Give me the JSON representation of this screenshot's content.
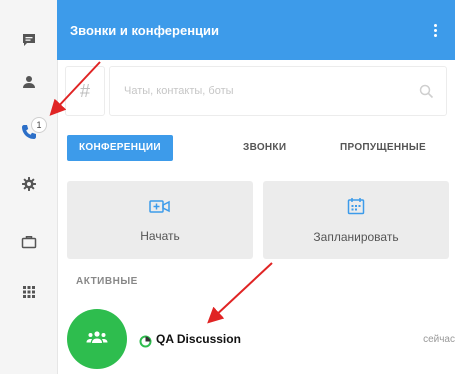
{
  "header": {
    "title": "Звонки и конференции",
    "menu_icon": "more-vertical-icon"
  },
  "sidebar": {
    "items": [
      {
        "icon": "chat-icon"
      },
      {
        "icon": "contacts-icon"
      },
      {
        "icon": "phone-icon",
        "badge": "1"
      },
      {
        "icon": "settings-icon"
      },
      {
        "icon": "briefcase-icon"
      },
      {
        "icon": "apps-grid-icon"
      }
    ]
  },
  "search": {
    "hash_icon": "#",
    "placeholder": "Чаты, контакты, боты"
  },
  "tabs": [
    {
      "label": "КОНФЕРЕНЦИИ",
      "active": true
    },
    {
      "label": "ЗВОНКИ",
      "active": false
    },
    {
      "label": "ПРОПУЩЕННЫЕ",
      "active": false
    }
  ],
  "actions": [
    {
      "label": "Начать",
      "icon": "video-add-icon"
    },
    {
      "label": "Запланировать",
      "icon": "calendar-icon"
    }
  ],
  "active_section": {
    "title": "АКТИВНЫЕ",
    "items": [
      {
        "name": "QA Discussion",
        "time": "сейчас"
      }
    ]
  },
  "colors": {
    "accent": "#3d9bea",
    "avatar": "#2ebd4e",
    "arrow": "#e02424"
  }
}
